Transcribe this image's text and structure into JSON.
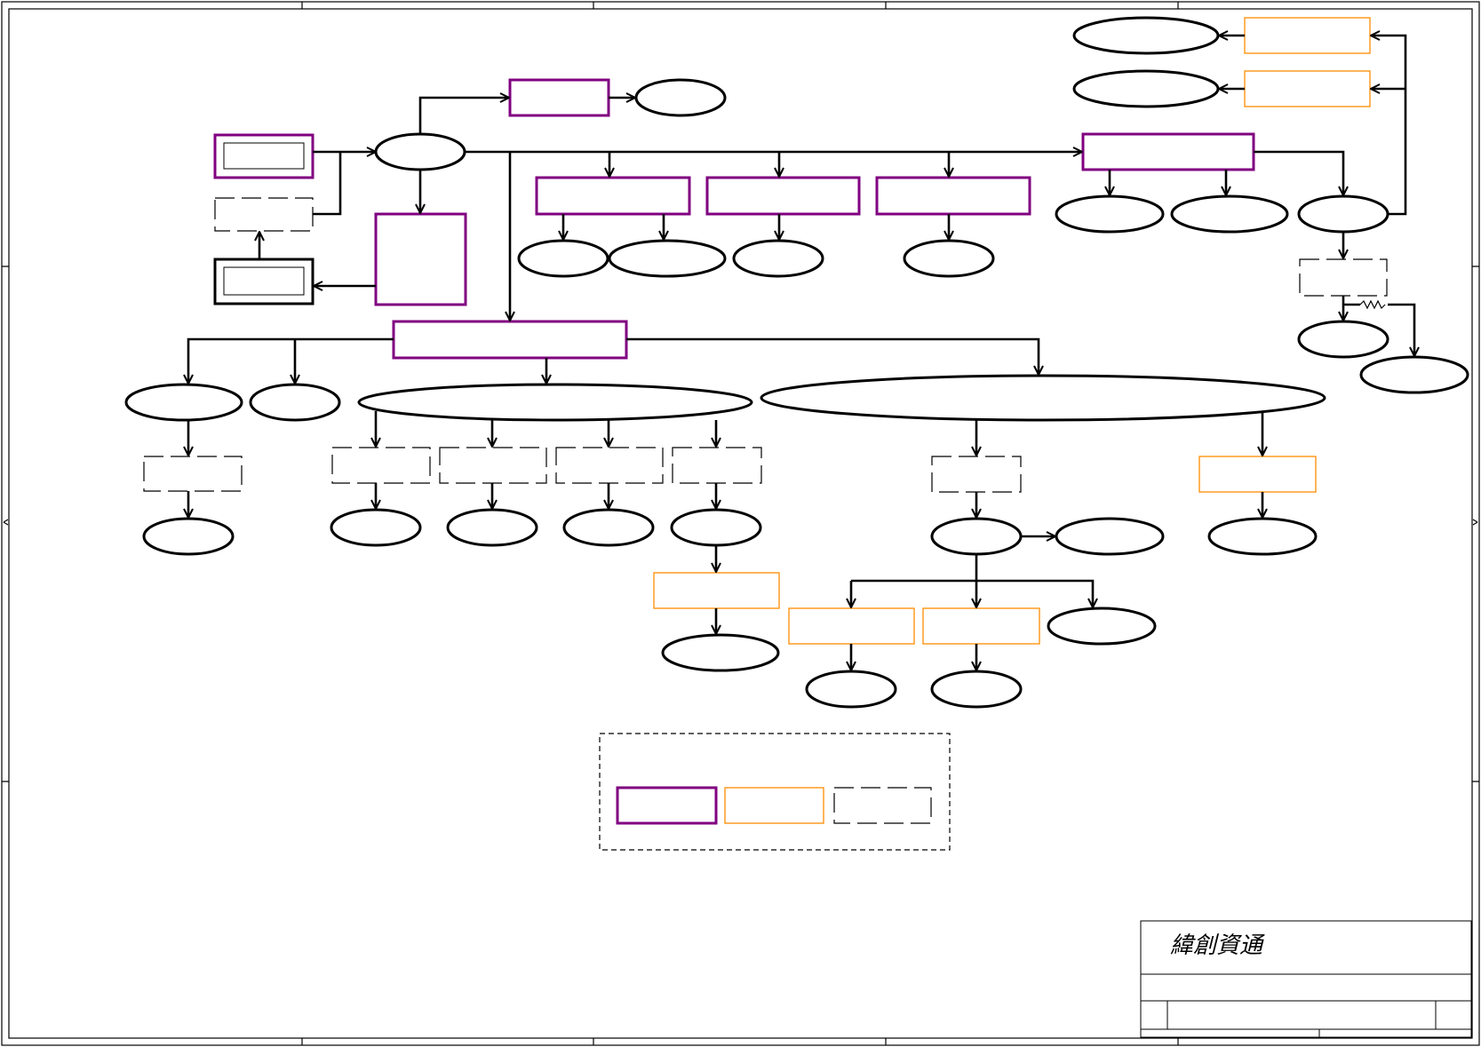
{
  "document": {
    "type": "schematic-block-diagram",
    "colors": {
      "line": "#000000",
      "primary_block": "#800080",
      "secondary_block": "#ff8c00",
      "optional_block": "#000000"
    },
    "legend": {
      "items": [
        {
          "key": "primary",
          "style": "solid-purple"
        },
        {
          "key": "secondary",
          "style": "solid-orange"
        },
        {
          "key": "optional",
          "style": "dashed-black"
        }
      ]
    },
    "title_block": {
      "company": "緯創資通",
      "logo_icon": "wistron-logo-icon"
    }
  }
}
